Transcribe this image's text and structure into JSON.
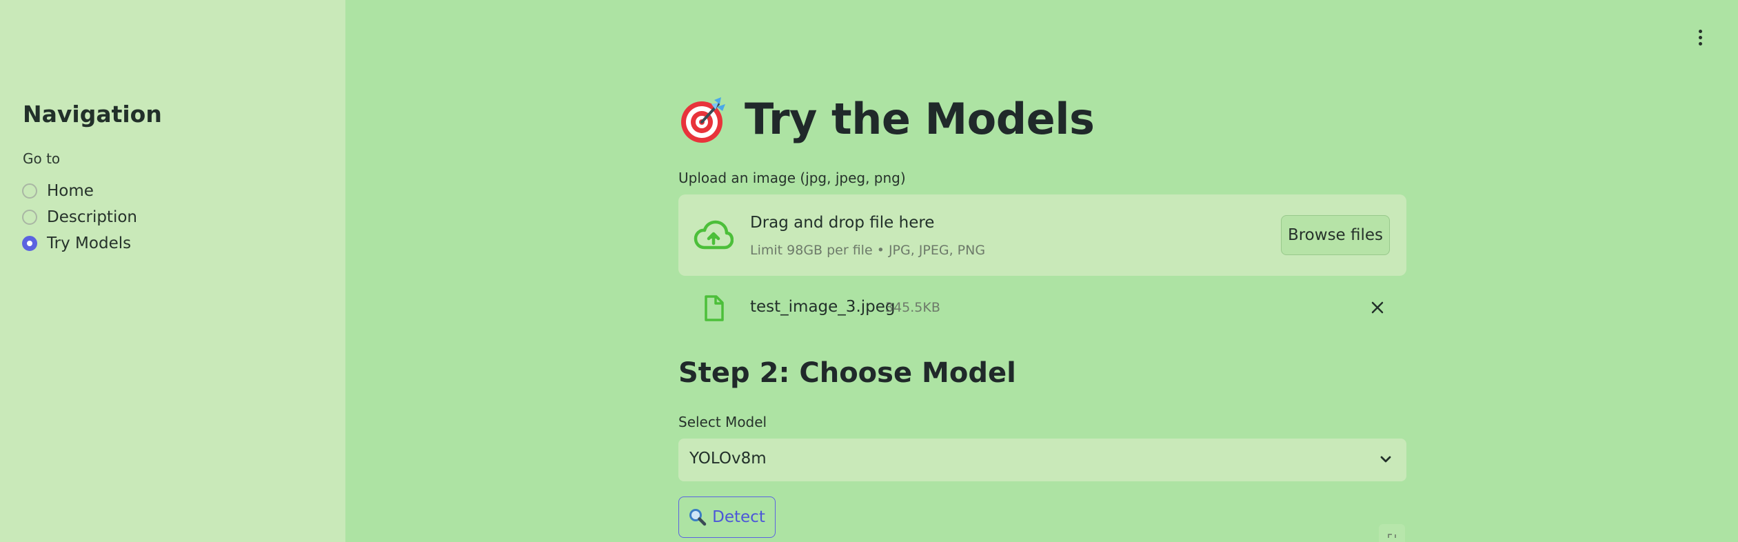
{
  "sidebar": {
    "title": "Navigation",
    "goto_label": "Go to",
    "options": [
      {
        "label": "Home",
        "checked": false
      },
      {
        "label": "Description",
        "checked": false
      },
      {
        "label": "Try Models",
        "checked": true
      }
    ]
  },
  "header": {
    "menu_icon": "more-vertical-icon"
  },
  "main": {
    "title_icon": "target-dart-icon",
    "title": "Try the Models",
    "upload": {
      "label": "Upload an image (jpg, jpeg, png)",
      "drop_title": "Drag and drop file here",
      "drop_subtitle": "Limit 98GB per file • JPG, JPEG, PNG",
      "browse_label": "Browse files",
      "icon": "cloud-upload-icon"
    },
    "file": {
      "name": "test_image_3.jpeg",
      "size": "345.5KB",
      "icon": "file-icon",
      "remove_icon": "close-icon"
    },
    "step2": {
      "title": "Step 2: Choose Model",
      "select_label": "Select Model",
      "selected": "YOLOv8m"
    },
    "detect": {
      "label": "Detect",
      "icon": "magnifier-icon"
    }
  },
  "colors": {
    "background": "#ade3a3",
    "sidebar": "#c9e9b9",
    "accent": "#5b63e0",
    "icon_green": "#4cbf3a"
  }
}
